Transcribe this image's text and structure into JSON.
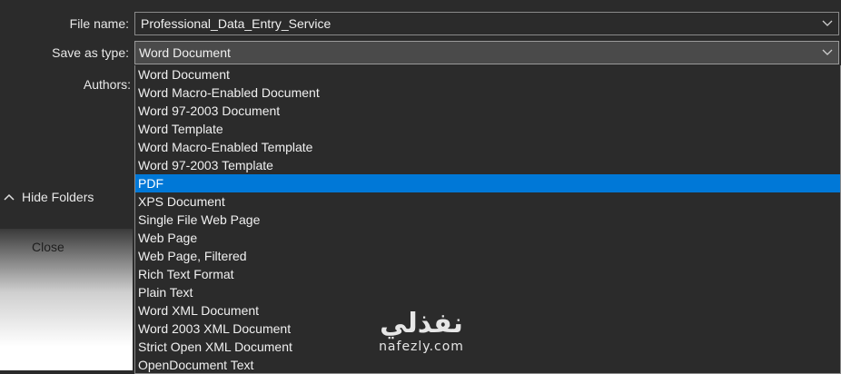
{
  "labels": {
    "file_name": "File name:",
    "save_as_type": "Save as type:",
    "authors": "Authors:"
  },
  "file_name_value": "Professional_Data_Entry_Service",
  "save_as_type_value": "Word Document",
  "dropdown_options": [
    "Word Document",
    "Word Macro-Enabled Document",
    "Word 97-2003 Document",
    "Word Template",
    "Word Macro-Enabled Template",
    "Word 97-2003 Template",
    "PDF",
    "XPS Document",
    "Single File Web Page",
    "Web Page",
    "Web Page, Filtered",
    "Rich Text Format",
    "Plain Text",
    "Word XML Document",
    "Word 2003 XML Document",
    "Strict Open XML Document",
    "OpenDocument Text"
  ],
  "selected_option": "PDF",
  "hide_folders_label": "Hide Folders",
  "close_label": "Close",
  "watermark": {
    "arabic": "نفذلي",
    "latin": "nafezly.com"
  },
  "colors": {
    "highlight": "#0078d7",
    "dialog_bg": "#2b2b2b"
  }
}
